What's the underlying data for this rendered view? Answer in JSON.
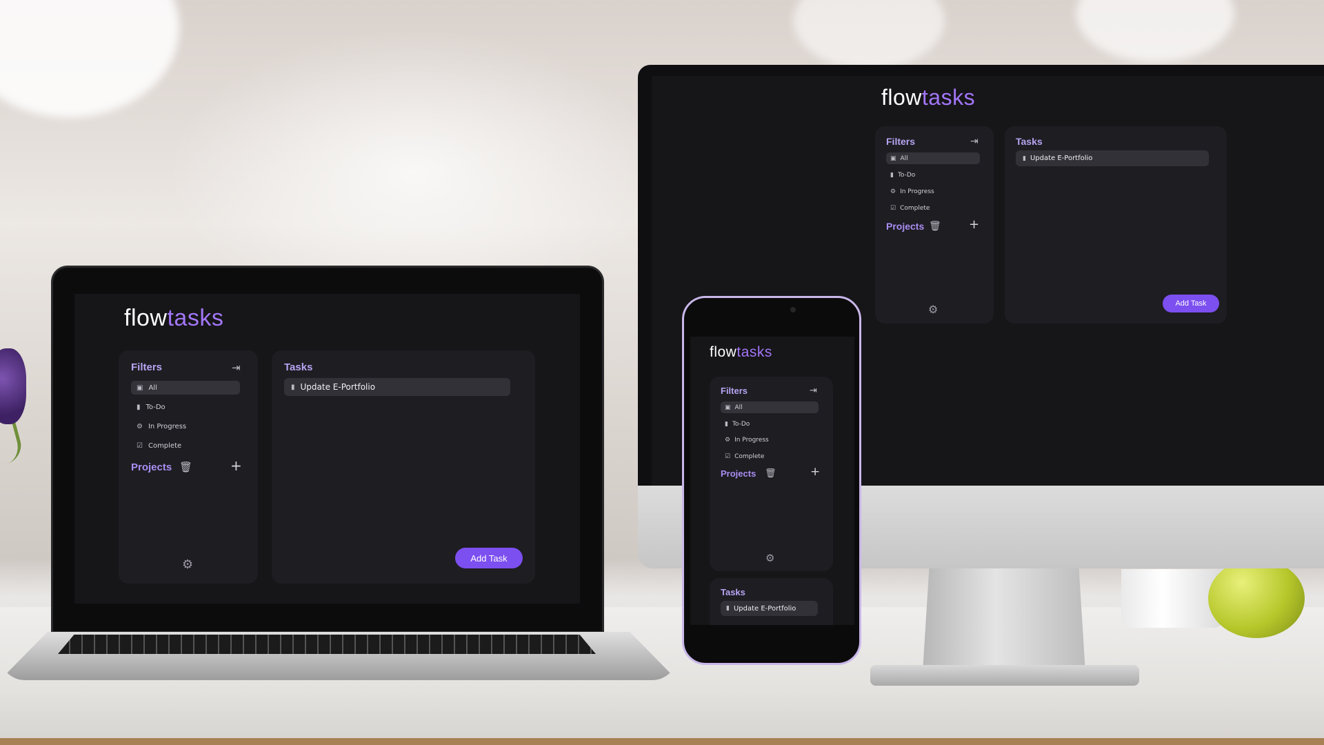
{
  "app": {
    "brand_part1": "flow",
    "brand_part2": "tasks"
  },
  "filters": {
    "title": "Filters",
    "items": [
      {
        "label": "All",
        "icon": "inbox-icon"
      },
      {
        "label": "To-Do",
        "icon": "clipboard-icon"
      },
      {
        "label": "In Progress",
        "icon": "cogs-icon"
      },
      {
        "label": "Complete",
        "icon": "check-square-icon"
      }
    ],
    "logout_icon": "logout-icon"
  },
  "projects": {
    "title": "Projects",
    "delete_icon": "trash-icon",
    "add_icon": "plus-icon"
  },
  "settings_icon": "gear-icon",
  "tasks": {
    "title": "Tasks",
    "items": [
      {
        "label": "Update E-Portfolio",
        "icon": "clipboard-icon"
      }
    ],
    "add_label": "Add Task"
  },
  "colors": {
    "background": "#161518",
    "panel": "#1e1d22",
    "accent": "#7c4ff0",
    "brand_accent": "#a276f7",
    "heading": "#a98ef2"
  }
}
